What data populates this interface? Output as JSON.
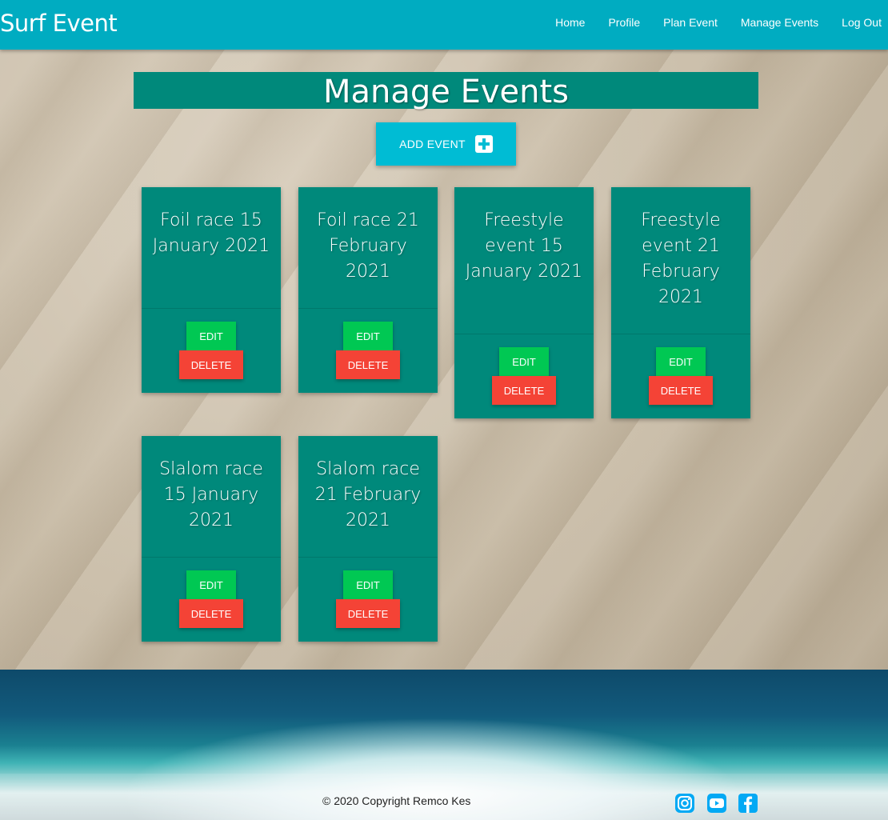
{
  "navbar": {
    "brand": "Surf Event",
    "links": [
      "Home",
      "Profile",
      "Plan Event",
      "Manage Events",
      "Log Out"
    ]
  },
  "page": {
    "title": "Manage Events",
    "add_event_label": "ADD EVENT"
  },
  "events": [
    {
      "title": "Foil race 15 January 2021",
      "edit_label": "EDIT",
      "delete_label": "DELETE"
    },
    {
      "title": "Foil race 21 February 2021",
      "edit_label": "EDIT",
      "delete_label": "DELETE"
    },
    {
      "title": "Freestyle event 15 January 2021",
      "edit_label": "EDIT",
      "delete_label": "DELETE"
    },
    {
      "title": "Freestyle event 21 February 2021",
      "edit_label": "EDIT",
      "delete_label": "DELETE"
    },
    {
      "title": "Slalom race 15 January 2021",
      "edit_label": "EDIT",
      "delete_label": "DELETE"
    },
    {
      "title": "Slalom race 21 February 2021",
      "edit_label": "EDIT",
      "delete_label": "DELETE"
    }
  ],
  "footer": {
    "copyright": "© 2020 Copyright Remco Kes",
    "social_icons": [
      "instagram-icon",
      "youtube-icon",
      "facebook-icon"
    ]
  },
  "colors": {
    "navbar": "#00acc1",
    "card": "#00897b",
    "add_button": "#00bcd4",
    "edit_button": "#00c853",
    "delete_button": "#f44336",
    "social_icon": "#03a9f4"
  }
}
